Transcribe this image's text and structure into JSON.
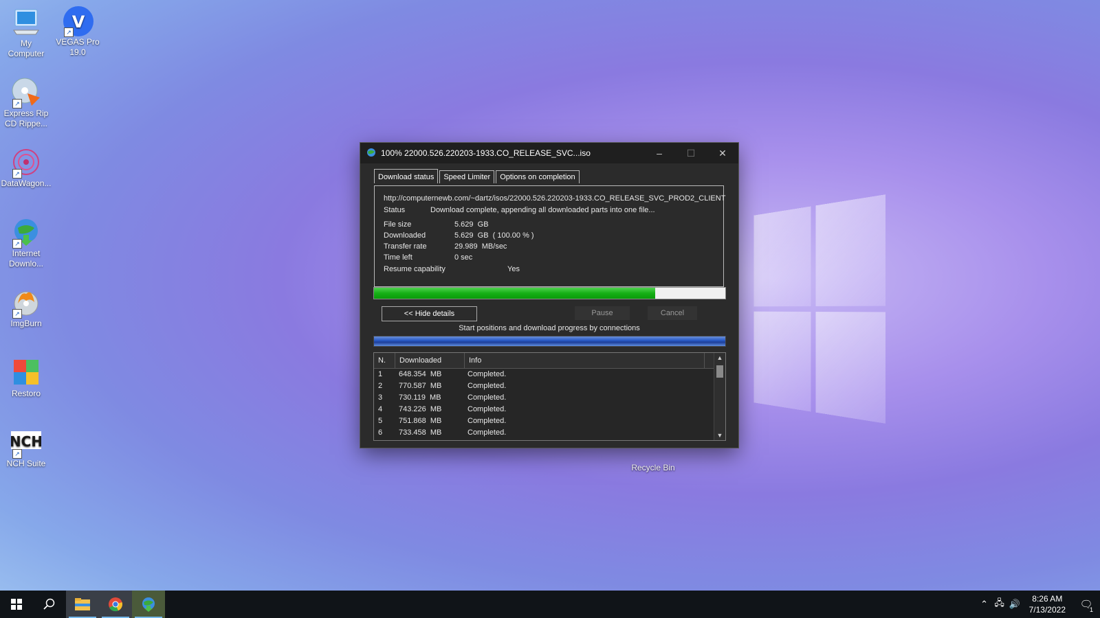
{
  "desktop": {
    "icons": [
      {
        "label": "My\nComputer"
      },
      {
        "label": "VEGAS Pro\n19.0"
      },
      {
        "label": "Express Rip\nCD Rippe..."
      },
      {
        "label": "DataWagon..."
      },
      {
        "label": "Internet\nDownlo..."
      },
      {
        "label": "ImgBurn"
      },
      {
        "label": "Restoro"
      },
      {
        "label": "NCH Suite"
      },
      {
        "label": "Recycle Bin"
      }
    ]
  },
  "dialog": {
    "title": "100% 22000.526.220203-1933.CO_RELEASE_SVC...iso",
    "tabs": [
      "Download status",
      "Speed Limiter",
      "Options on completion"
    ],
    "url": "http://computernewb.com/~dartz/isos/22000.526.220203-1933.CO_RELEASE_SVC_PROD2_CLIENT",
    "status_label": "Status",
    "status_value": "Download complete, appending all downloaded parts into one file...",
    "file_size_label": "File size",
    "file_size_value": "5.629  GB",
    "downloaded_label": "Downloaded",
    "downloaded_value": "5.629  GB  ( 100.00 % )",
    "transfer_label": "Transfer rate",
    "transfer_value": "29.989  MB/sec",
    "time_left_label": "Time left",
    "time_left_value": "0 sec",
    "resume_label": "Resume capability",
    "resume_value": "Yes",
    "progress_percent": 80,
    "hide_details_label": "<< Hide details",
    "pause_label": "Pause",
    "cancel_label": "Cancel",
    "connections_label": "Start positions and download progress by connections",
    "table": {
      "headers": [
        "N.",
        "Downloaded",
        "Info"
      ],
      "rows": [
        [
          "1",
          "648.354  MB",
          "Completed."
        ],
        [
          "2",
          "770.587  MB",
          "Completed."
        ],
        [
          "3",
          "730.119  MB",
          "Completed."
        ],
        [
          "4",
          "743.226  MB",
          "Completed."
        ],
        [
          "5",
          "751.868  MB",
          "Completed."
        ],
        [
          "6",
          "733.458  MB",
          "Completed."
        ]
      ]
    }
  },
  "taskbar": {
    "time": "8:26 AM",
    "date": "7/13/2022",
    "notification_count": "1"
  }
}
